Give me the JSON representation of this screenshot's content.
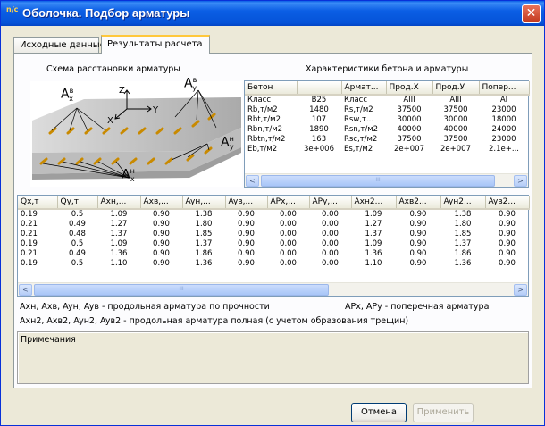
{
  "window": {
    "title": "Оболочка. Подбор арматуры",
    "close_glyph": "✕",
    "icon_text": "n/c"
  },
  "tabs": [
    {
      "label": "Исходные данные"
    },
    {
      "label": "Результаты расчета"
    }
  ],
  "scheme": {
    "title": "Схема расстановки арматуры",
    "label_axb": "A",
    "label_axb_sup": "в",
    "label_axb_sub": "x",
    "label_ayb": "A",
    "label_ayb_sup": "в",
    "label_ayb_sub": "y",
    "label_ayn": "A",
    "label_ayn_sup": "н",
    "label_ayn_sub": "y",
    "label_axn": "A",
    "label_axn_sup": "н",
    "label_axn_sub": "x",
    "axis_x": "X",
    "axis_y": "Y",
    "axis_z": "Z"
  },
  "characteristics": {
    "title": "Характеристики бетона и арматуры",
    "headers": [
      "Бетон",
      "",
      "Армат...",
      "Прод.X",
      "Прод.У",
      "Попер..."
    ],
    "rows": [
      [
        "Класс",
        "B25",
        "Класс",
        "AIII",
        "AIII",
        "AI"
      ],
      [
        "Rb,т/м2",
        "1480",
        "Rs,т/м2",
        "37500",
        "37500",
        "23000"
      ],
      [
        "Rbt,т/м2",
        "107",
        "Rsw,т...",
        "30000",
        "30000",
        "18000"
      ],
      [
        "Rbn,т/м2",
        "1890",
        "Rsn,т/м2",
        "40000",
        "40000",
        "24000"
      ],
      [
        "Rbtn,т/м2",
        "163",
        "Rsc,т/м2",
        "37500",
        "37500",
        "23000"
      ],
      [
        "Eb,т/м2",
        "3e+006",
        "Es,т/м2",
        "2e+007",
        "2e+007",
        "2.1e+..."
      ]
    ]
  },
  "results": {
    "headers": [
      "Qx,т",
      "Qy,т",
      "Axн,...",
      "Axв,...",
      "Ayн,...",
      "Ayв,...",
      "APx,...",
      "APy,...",
      "Axн2...",
      "Axв2...",
      "Ayн2...",
      "Ayв2..."
    ],
    "rows": [
      [
        "0.19",
        "0.5",
        "1.09",
        "0.90",
        "1.38",
        "0.90",
        "0.00",
        "0.00",
        "1.09",
        "0.90",
        "1.38",
        "0.90"
      ],
      [
        "0.21",
        "0.49",
        "1.27",
        "0.90",
        "1.80",
        "0.90",
        "0.00",
        "0.00",
        "1.27",
        "0.90",
        "1.80",
        "0.90"
      ],
      [
        "0.21",
        "0.48",
        "1.37",
        "0.90",
        "1.85",
        "0.90",
        "0.00",
        "0.00",
        "1.37",
        "0.90",
        "1.85",
        "0.90"
      ],
      [
        "0.19",
        "0.5",
        "1.09",
        "0.90",
        "1.37",
        "0.90",
        "0.00",
        "0.00",
        "1.09",
        "0.90",
        "1.37",
        "0.90"
      ],
      [
        "0.21",
        "0.49",
        "1.36",
        "0.90",
        "1.86",
        "0.90",
        "0.00",
        "0.00",
        "1.36",
        "0.90",
        "1.86",
        "0.90"
      ],
      [
        "0.19",
        "0.5",
        "1.10",
        "0.90",
        "1.36",
        "0.90",
        "0.00",
        "0.00",
        "1.10",
        "0.90",
        "1.36",
        "0.90"
      ]
    ]
  },
  "legend": {
    "line1_left": "Axн, Axв, Ayн, Ayв - продольная арматура по прочности",
    "line1_right": "APx, APy - поперечная арматура",
    "line2": "Axн2, Axв2, Ayн2, Ayв2 - продольная арматура  полная (с учетом образования трещин)"
  },
  "notes": {
    "label": "Примечания"
  },
  "buttons": {
    "cancel": "Отмена",
    "apply": "Применить"
  },
  "scroll": {
    "left": "<",
    "right": ">",
    "thumb": "III"
  }
}
